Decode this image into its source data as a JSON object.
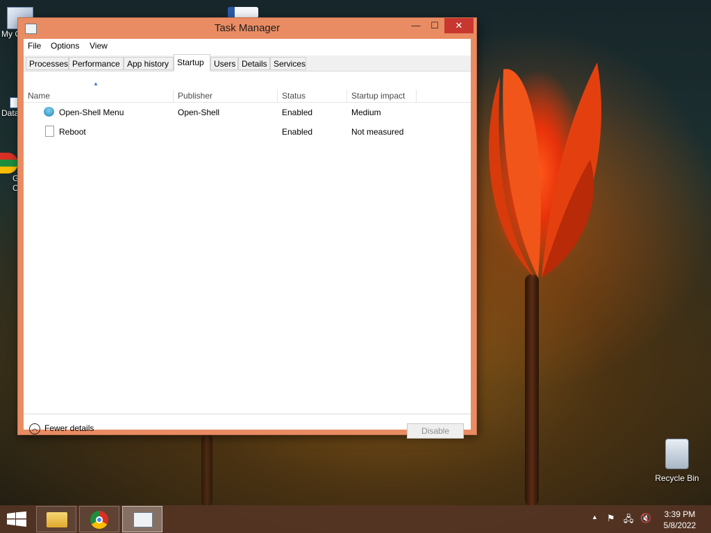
{
  "desktop": {
    "icons": [
      {
        "label": "My C"
      },
      {
        "label": "Data"
      },
      {
        "label": "G"
      },
      {
        "label": "C"
      },
      {
        "label": "Recycle Bin"
      }
    ]
  },
  "window": {
    "title": "Task Manager",
    "controls": {
      "minimize": "—",
      "maximize": "☐",
      "close": "✕"
    },
    "menu": [
      "File",
      "Options",
      "View"
    ],
    "tabs": [
      "Processes",
      "Performance",
      "App history",
      "Startup",
      "Users",
      "Details",
      "Services"
    ],
    "active_tab": "Startup",
    "columns": [
      "Name",
      "Publisher",
      "Status",
      "Startup impact"
    ],
    "rows": [
      {
        "icon": "open-shell-icon",
        "name": "Open-Shell Menu",
        "publisher": "Open-Shell",
        "status": "Enabled",
        "impact": "Medium"
      },
      {
        "icon": "file-icon",
        "name": "Reboot",
        "publisher": "",
        "status": "Enabled",
        "impact": "Not measured"
      }
    ],
    "footer": {
      "fewer_details": "Fewer details",
      "disable": "Disable"
    }
  },
  "taskbar": {
    "apps": [
      {
        "icon": "file-explorer-icon"
      },
      {
        "icon": "chrome-icon"
      },
      {
        "icon": "task-manager-icon"
      }
    ],
    "clock": {
      "time": "3:39 PM",
      "date": "5/8/2022"
    }
  },
  "colors": {
    "window_frame": "#e98c63",
    "close_button": "#c7372f",
    "taskbar": "#553424"
  }
}
